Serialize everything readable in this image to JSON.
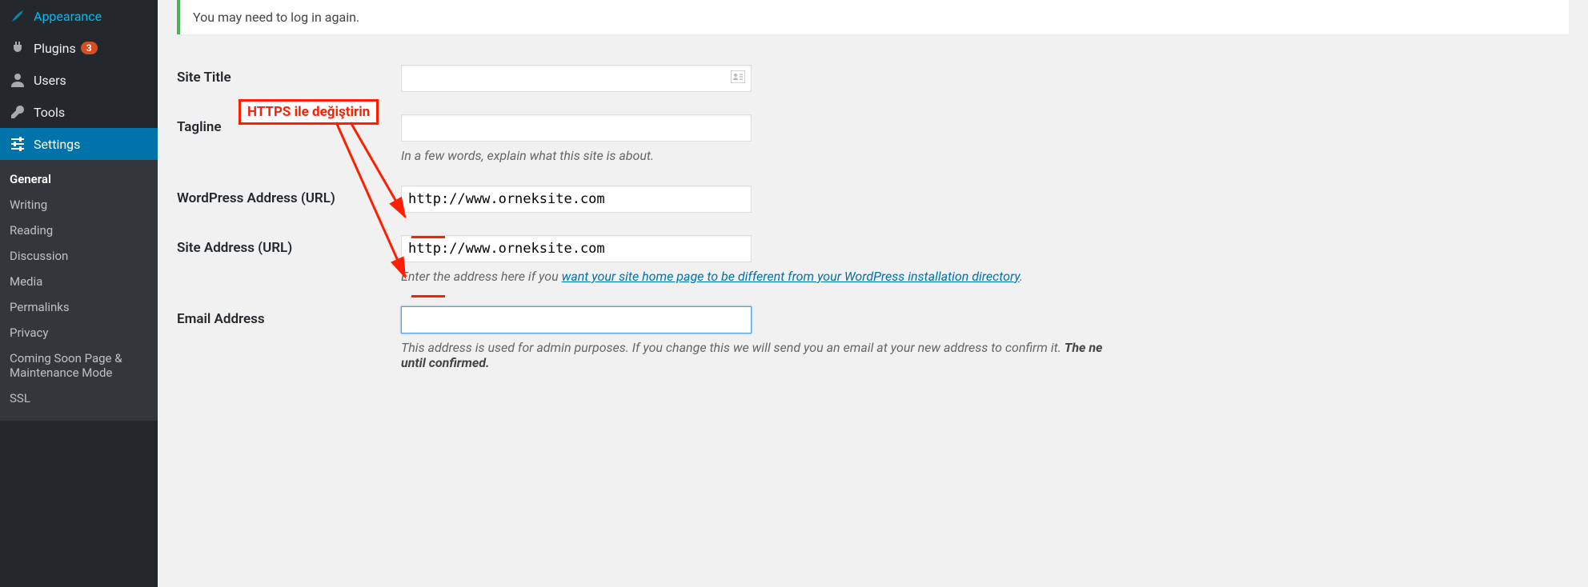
{
  "sidebar": {
    "items": [
      {
        "label": "Appearance",
        "icon": "brush-icon"
      },
      {
        "label": "Plugins",
        "icon": "plug-icon",
        "badge": "3"
      },
      {
        "label": "Users",
        "icon": "user-icon"
      },
      {
        "label": "Tools",
        "icon": "wrench-icon"
      },
      {
        "label": "Settings",
        "icon": "sliders-icon",
        "current": true
      }
    ],
    "submenu": [
      {
        "label": "General",
        "current": true
      },
      {
        "label": "Writing"
      },
      {
        "label": "Reading"
      },
      {
        "label": "Discussion"
      },
      {
        "label": "Media"
      },
      {
        "label": "Permalinks"
      },
      {
        "label": "Privacy"
      },
      {
        "label": "Coming Soon Page & Maintenance Mode"
      },
      {
        "label": "SSL"
      }
    ]
  },
  "notice": "You may need to log in again.",
  "form": {
    "site_title": {
      "label": "Site Title",
      "value": ""
    },
    "tagline": {
      "label": "Tagline",
      "value": "",
      "description": "In a few words, explain what this site is about."
    },
    "wp_url": {
      "label": "WordPress Address (URL)",
      "value": "http://www.orneksite.com"
    },
    "site_url": {
      "label": "Site Address (URL)",
      "value": "http://www.orneksite.com",
      "desc_prefix": "Enter the address here if you ",
      "desc_link": "want your site home page to be different from your WordPress installation directory",
      "desc_suffix": "."
    },
    "email": {
      "label": "Email Address",
      "value": "",
      "desc_a": "This address is used for admin purposes. If you change this we will send you an email at your new address to confirm it. ",
      "desc_b": "The ne",
      "desc_c": "until confirmed."
    }
  },
  "annotation": {
    "label": "HTTPS ile değiştirin"
  }
}
